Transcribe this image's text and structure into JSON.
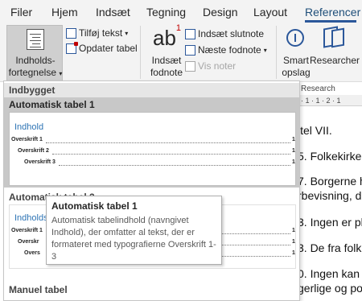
{
  "tabs": [
    "Filer",
    "Hjem",
    "Indsæt",
    "Tegning",
    "Design",
    "Layout",
    "Referencer"
  ],
  "active_tab": "Referencer",
  "accent_color": "#2b579a",
  "ribbon": {
    "toc_label_1": "Indholds-",
    "toc_label_2": "fortegnelse",
    "add_text": "Tilføj tekst",
    "update_table": "Opdater tabel",
    "insert_footnote_1": "Indsæt",
    "insert_footnote_2": "fodnote",
    "insert_endnote": "Indsæt slutnote",
    "next_footnote": "Næste fodnote",
    "show_notes": "Vis noter",
    "footnote_glyph": "ab",
    "footnote_sup": "1",
    "endnote_glyph": "a",
    "smart_1": "Smart",
    "smart_2": "opslag",
    "researcher": "Researcher",
    "icons": {
      "toc": "table-of-contents-icon",
      "add_text": "add-text-icon",
      "update_table": "update-table-icon",
      "endnote": "endnote-icon",
      "next_footnote": "next-footnote-icon",
      "show_notes": "show-notes-icon",
      "smart_lookup": "smart-lookup-icon",
      "researcher": "researcher-icon"
    }
  },
  "document": {
    "research_label": "Research",
    "ruler_text": "· 1 · 1 · 2 · 1",
    "lines": [
      "itel VII.",
      "5. Folkekirke",
      "7. Borgerne h",
      "rbevisning, d",
      "3. Ingen er pl",
      "3. De fra folk",
      "0. Ingen kan p",
      "gerlige og po"
    ]
  },
  "gallery": {
    "section_builtin": "Indbygget",
    "item1_title": "Automatisk tabel 1",
    "item2_title": "Automatisk tabel 2",
    "manual_title": "Manuel tabel",
    "preview1": {
      "heading": "Indhold",
      "rows": [
        {
          "label": "Overskrift 1",
          "page": "1"
        },
        {
          "label": "Overskrift 2",
          "page": "1"
        },
        {
          "label": "Overskrift 3",
          "page": "1"
        }
      ]
    },
    "preview2": {
      "heading": "Indholdsf",
      "rows": [
        {
          "label": "Overskrift 1",
          "page": "1"
        },
        {
          "label": "Overskr",
          "page": "1"
        },
        {
          "label": "Overs",
          "page": "1"
        }
      ]
    }
  },
  "tooltip": {
    "title": "Automatisk tabel 1",
    "body": "Automatisk tabelindhold (navngivet Indhold), der omfatter al tekst, der er formateret med typografierne Overskrift 1-3"
  }
}
